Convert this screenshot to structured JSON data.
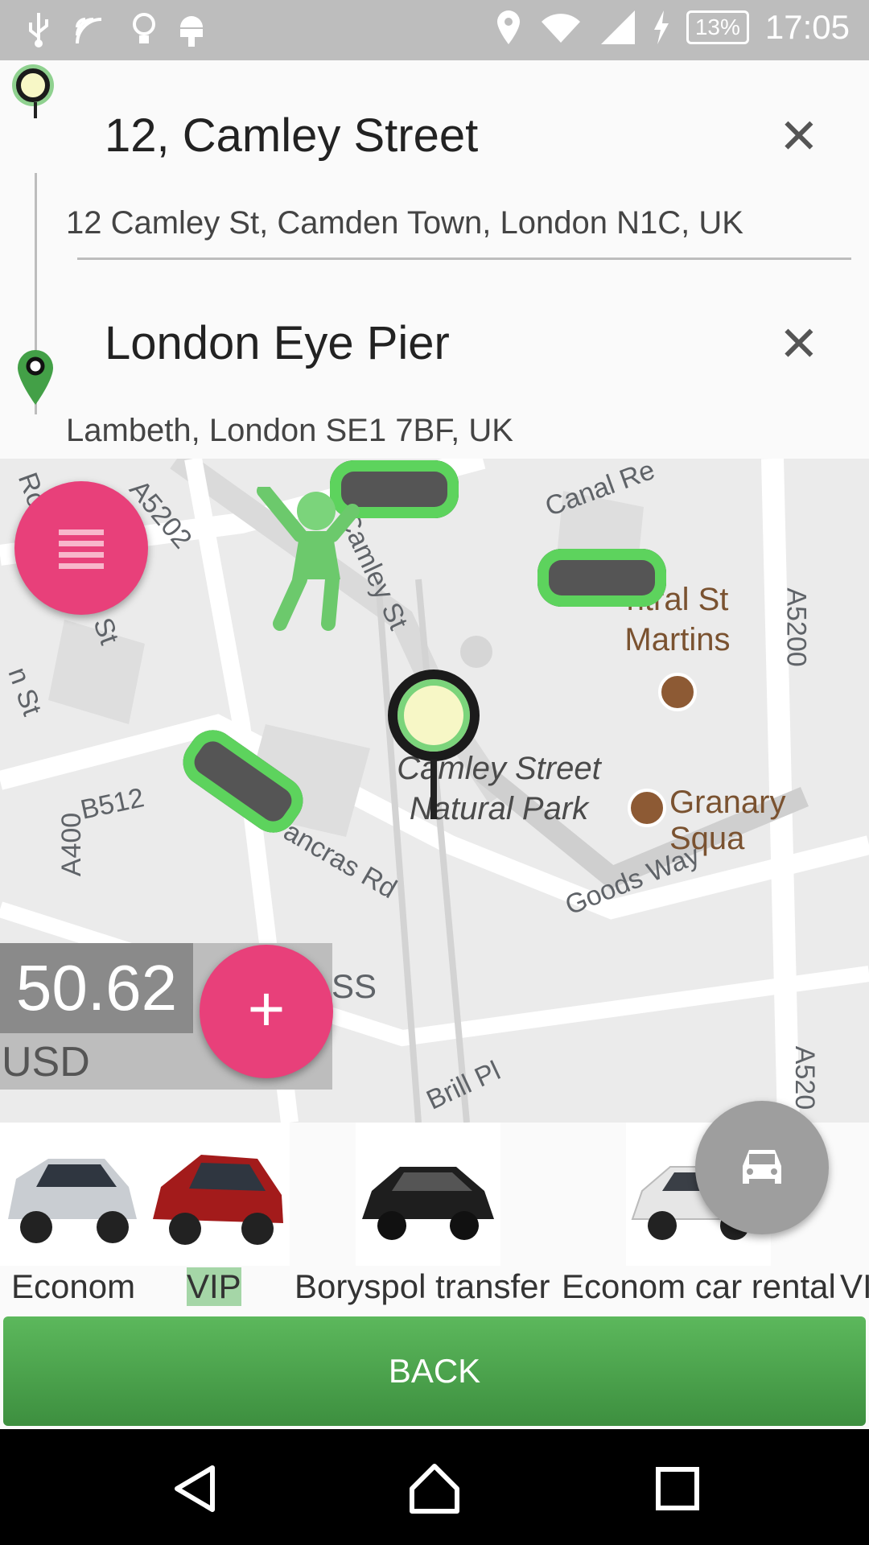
{
  "status_bar": {
    "battery": "13%",
    "time": "17:05"
  },
  "route": {
    "origin": {
      "name": "12, Camley Street",
      "address": "12 Camley St, Camden Town, London N1C, UK"
    },
    "destination": {
      "name": "London Eye Pier",
      "address": "Lambeth, London SE1 7BF, UK"
    },
    "clear_symbol": "✕"
  },
  "map": {
    "labels": {
      "canal_rd": "Canal Re",
      "a5202": "A5202",
      "camley_st": "Camley St",
      "ro": "Ro",
      "st": "St",
      "n_st": "n St",
      "a5200": "A5200",
      "b512": "B512",
      "a400": "A400",
      "pancras_rd": "ancras Rd",
      "goods_way": "Goods Way",
      "brill_pl": "Brill Pl",
      "ss": "SS",
      "a520": "A520"
    },
    "pois": {
      "central_st_martins": "ntral St Martins",
      "camley_park": "Camley Street Natural Park",
      "granary_square": "Granary Squa"
    }
  },
  "price": {
    "value": "50.62",
    "currency": "USD"
  },
  "car_categories": [
    {
      "label": "Econom",
      "selected": false
    },
    {
      "label": "VIP",
      "selected": true
    },
    {
      "label": "Boryspol transfer",
      "selected": false
    },
    {
      "label": "Econom car rental",
      "selected": false
    },
    {
      "label": "VI",
      "selected": false
    }
  ],
  "buttons": {
    "back": "BACK",
    "add": "+"
  },
  "colors": {
    "accent_pink": "#e8407a",
    "green": "#4caf50",
    "status_bar": "#bdbdbd"
  },
  "icons": {
    "menu": "menu-icon",
    "add": "plus-icon",
    "taxi": "taxi-icon",
    "clear": "close-icon"
  }
}
